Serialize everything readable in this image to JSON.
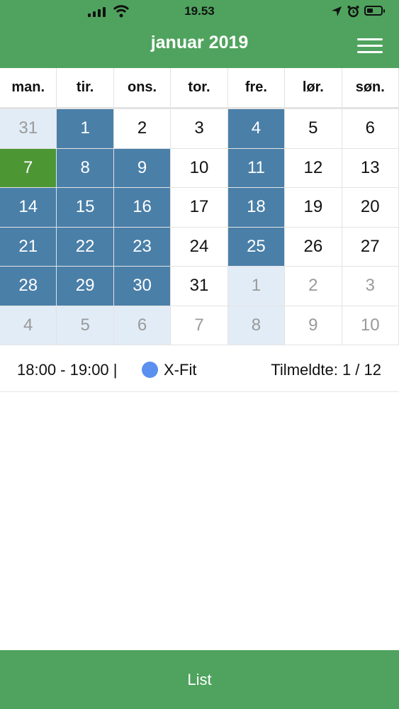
{
  "status_bar": {
    "time": "19.53",
    "battery_level": 0.45
  },
  "header": {
    "title": "januar 2019",
    "menu_icon": "hamburger-menu-icon"
  },
  "calendar": {
    "weekdays": [
      "man.",
      "tir.",
      "ons.",
      "tor.",
      "fre.",
      "lør.",
      "søn."
    ],
    "weeks": [
      [
        {
          "d": "31",
          "s": "other-event"
        },
        {
          "d": "1",
          "s": "event"
        },
        {
          "d": "2",
          "s": "plain"
        },
        {
          "d": "3",
          "s": "plain"
        },
        {
          "d": "4",
          "s": "event"
        },
        {
          "d": "5",
          "s": "plain"
        },
        {
          "d": "6",
          "s": "plain"
        }
      ],
      [
        {
          "d": "7",
          "s": "today"
        },
        {
          "d": "8",
          "s": "event"
        },
        {
          "d": "9",
          "s": "event"
        },
        {
          "d": "10",
          "s": "plain"
        },
        {
          "d": "11",
          "s": "event"
        },
        {
          "d": "12",
          "s": "plain"
        },
        {
          "d": "13",
          "s": "plain"
        }
      ],
      [
        {
          "d": "14",
          "s": "event"
        },
        {
          "d": "15",
          "s": "event"
        },
        {
          "d": "16",
          "s": "event"
        },
        {
          "d": "17",
          "s": "plain"
        },
        {
          "d": "18",
          "s": "event"
        },
        {
          "d": "19",
          "s": "plain"
        },
        {
          "d": "20",
          "s": "plain"
        }
      ],
      [
        {
          "d": "21",
          "s": "event"
        },
        {
          "d": "22",
          "s": "event"
        },
        {
          "d": "23",
          "s": "event"
        },
        {
          "d": "24",
          "s": "plain"
        },
        {
          "d": "25",
          "s": "event"
        },
        {
          "d": "26",
          "s": "plain"
        },
        {
          "d": "27",
          "s": "plain"
        }
      ],
      [
        {
          "d": "28",
          "s": "event"
        },
        {
          "d": "29",
          "s": "event"
        },
        {
          "d": "30",
          "s": "event"
        },
        {
          "d": "31",
          "s": "plain"
        },
        {
          "d": "1",
          "s": "other-event"
        },
        {
          "d": "2",
          "s": "other"
        },
        {
          "d": "3",
          "s": "other"
        }
      ],
      [
        {
          "d": "4",
          "s": "other-event"
        },
        {
          "d": "5",
          "s": "other-event"
        },
        {
          "d": "6",
          "s": "other-event"
        },
        {
          "d": "7",
          "s": "other"
        },
        {
          "d": "8",
          "s": "other-event"
        },
        {
          "d": "9",
          "s": "other"
        },
        {
          "d": "10",
          "s": "other"
        }
      ]
    ]
  },
  "event": {
    "time": "18:00 - 19:00 |",
    "name": "X-Fit",
    "dot_color": "#5b8ff0",
    "registered": "Tilmeldte: 1 / 12"
  },
  "footer": {
    "button_label": "List"
  },
  "colors": {
    "brand": "#4fa35e",
    "event": "#4a7fa8",
    "today": "#4c9634",
    "other_event": "#e2ecf6"
  }
}
